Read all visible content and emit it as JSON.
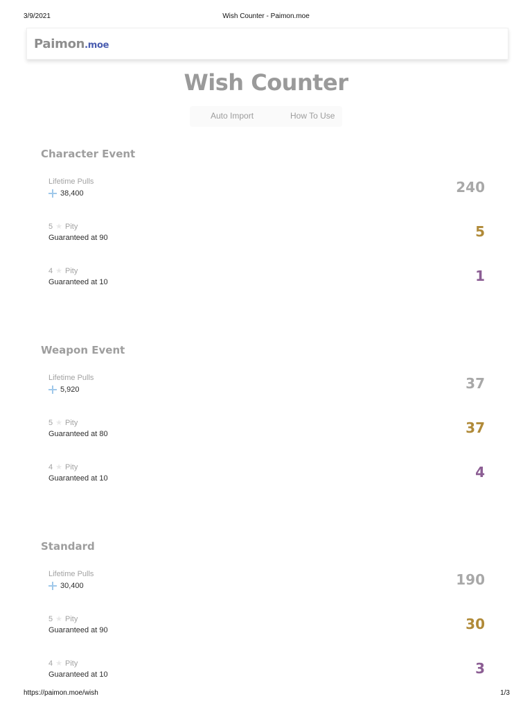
{
  "print_header": {
    "date": "3/9/2021",
    "title": "Wish Counter - Paimon.moe"
  },
  "navbar": {
    "logo_main": "Paimon",
    "logo_tld": ".moe"
  },
  "page": {
    "title": "Wish Counter"
  },
  "actions": {
    "auto_import": "Auto Import",
    "how_to_use": "How To Use"
  },
  "icons": {
    "primogem": "primogem-icon",
    "star": "star-icon"
  },
  "colors": {
    "five_star": "#b08a38",
    "four_star": "#8c5e94",
    "neutral": "#a8a8a8"
  },
  "sections": [
    {
      "title": "Character Event",
      "lifetime_label": "Lifetime Pulls",
      "primogems": "38,400",
      "lifetime_value": "240",
      "five_num": "5",
      "five_label": "Pity",
      "five_guarantee": "Guaranteed at 90",
      "five_value": "5",
      "four_num": "4",
      "four_label": "Pity",
      "four_guarantee": "Guaranteed at 10",
      "four_value": "1"
    },
    {
      "title": "Weapon Event",
      "lifetime_label": "Lifetime Pulls",
      "primogems": "5,920",
      "lifetime_value": "37",
      "five_num": "5",
      "five_label": "Pity",
      "five_guarantee": "Guaranteed at 80",
      "five_value": "37",
      "four_num": "4",
      "four_label": "Pity",
      "four_guarantee": "Guaranteed at 10",
      "four_value": "4"
    },
    {
      "title": "Standard",
      "lifetime_label": "Lifetime Pulls",
      "primogems": "30,400",
      "lifetime_value": "190",
      "five_num": "5",
      "five_label": "Pity",
      "five_guarantee": "Guaranteed at 90",
      "five_value": "30",
      "four_num": "4",
      "four_label": "Pity",
      "four_guarantee": "Guaranteed at 10",
      "four_value": "3"
    }
  ],
  "print_footer": {
    "url": "https://paimon.moe/wish",
    "page": "1/3"
  }
}
